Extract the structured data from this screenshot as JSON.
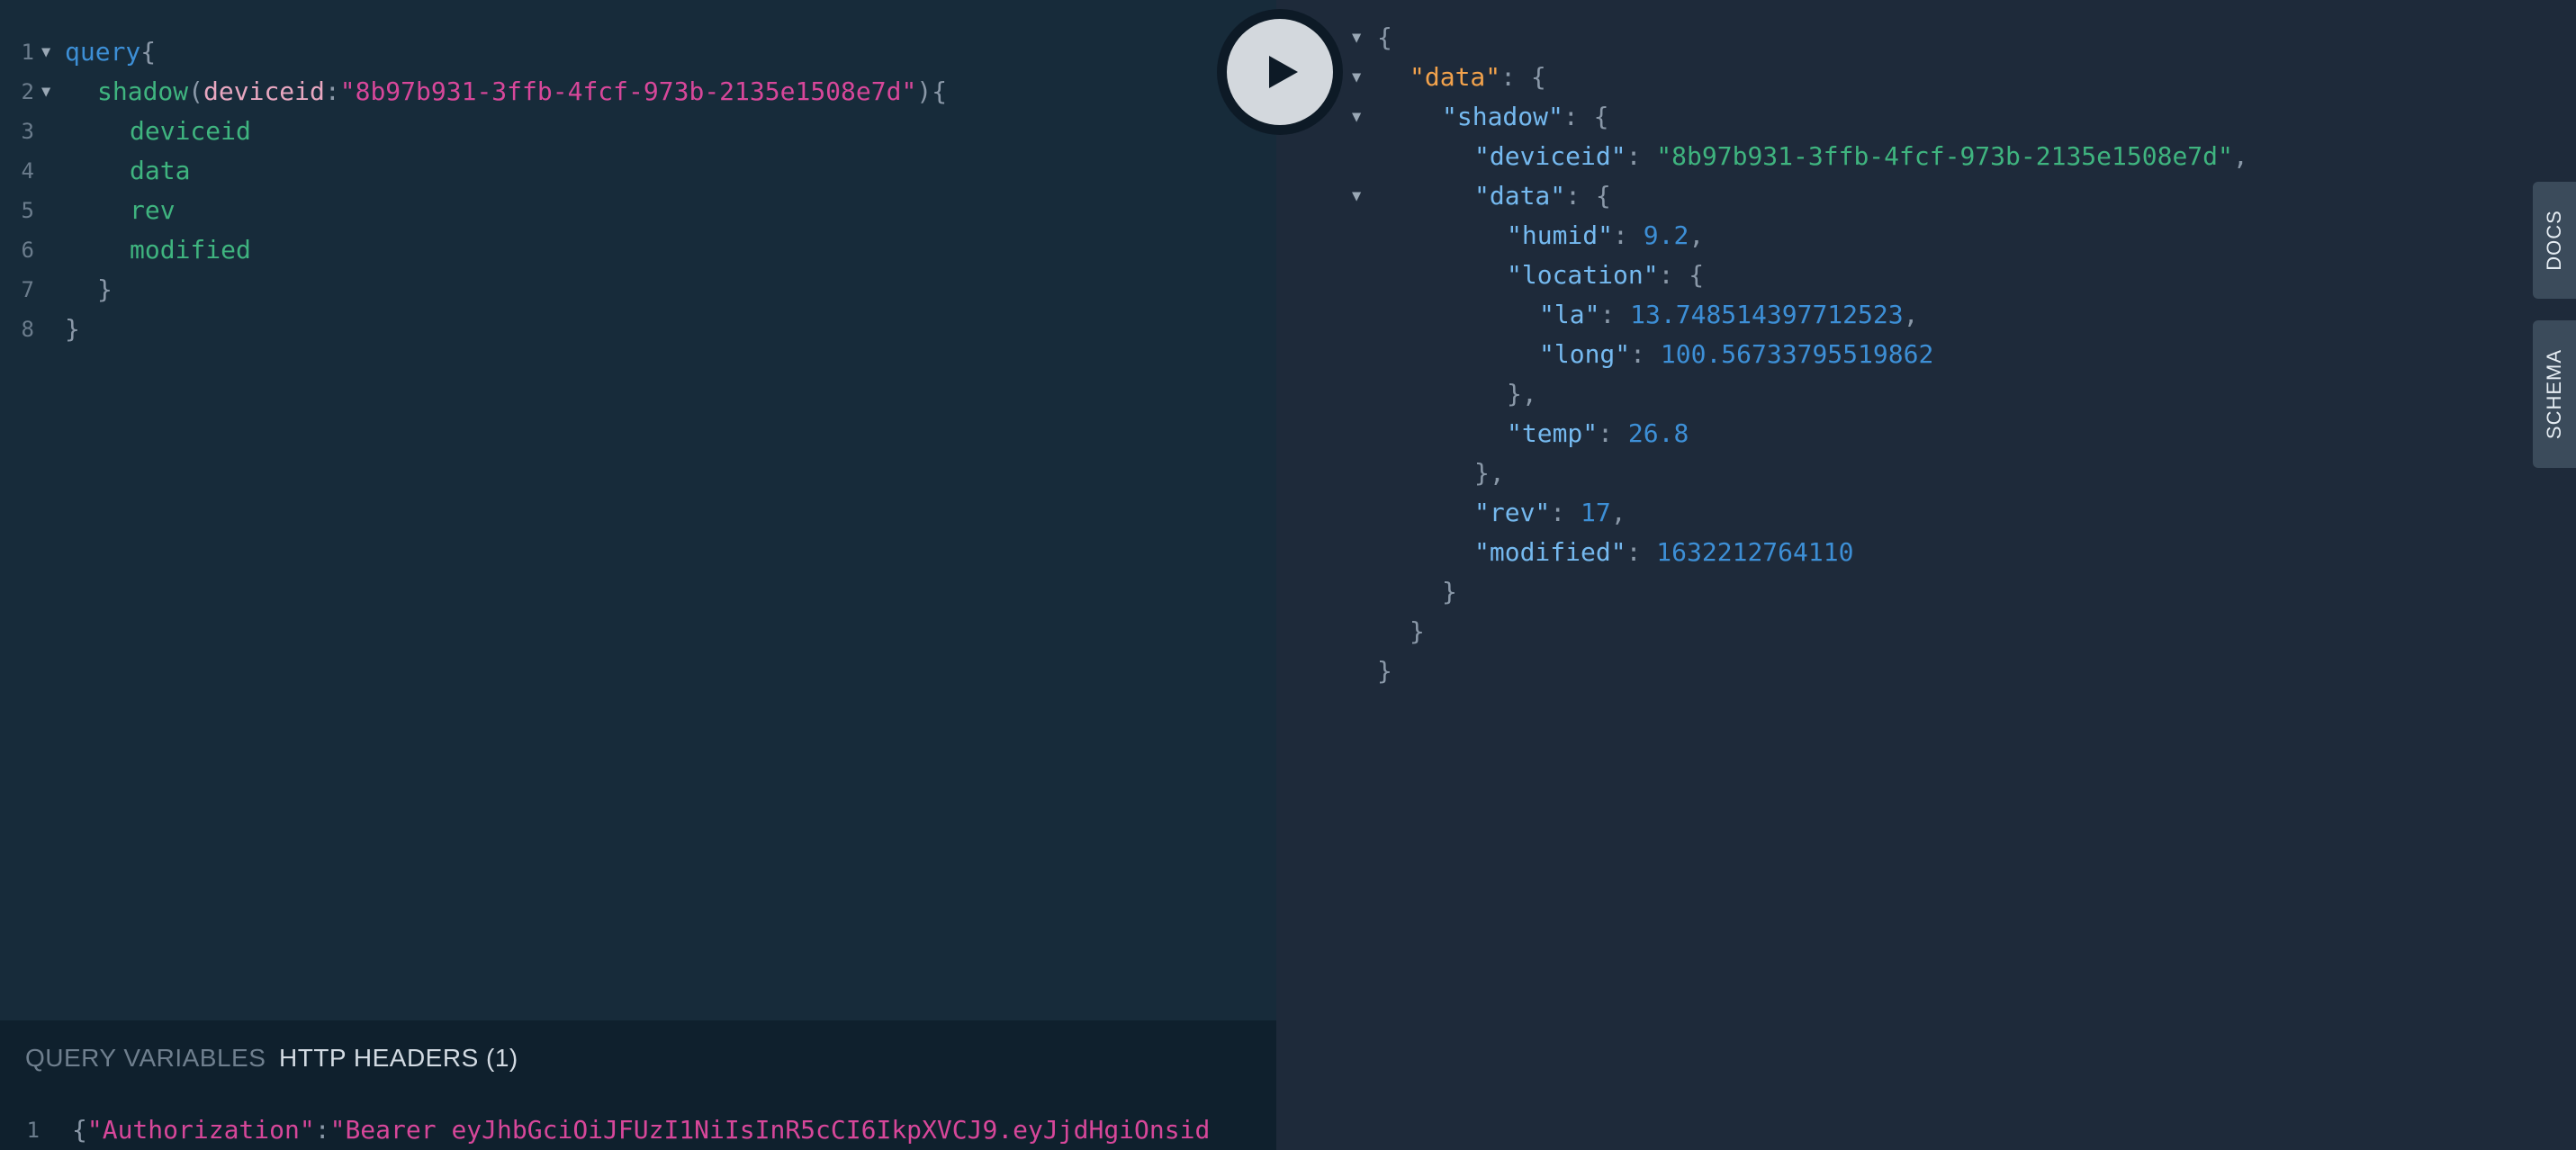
{
  "editor": {
    "line_numbers": [
      "1",
      "2",
      "3",
      "4",
      "5",
      "6",
      "7",
      "8"
    ],
    "query_keyword": "query",
    "open_brace": "{",
    "close_brace": "}",
    "shadow_field": "shadow",
    "paren_open": "(",
    "arg_name": "deviceid",
    "colon": ":",
    "arg_value": "\"8b97b931-3ffb-4fcf-973b-2135e1508e7d\"",
    "paren_close": ")",
    "fields": [
      "deviceid",
      "data",
      "rev",
      "modified"
    ]
  },
  "bottom_panel": {
    "tab_variables": "QUERY VARIABLES",
    "tab_headers": "HTTP HEADERS (1)",
    "line_number": "1",
    "header_open": "{",
    "header_key": "\"Authorization\"",
    "header_colon": ":",
    "header_value": "\"Bearer eyJhbGciOiJFUzI1NiIsInR5cCI6IkpXVCJ9.eyJjdHgiOnsid"
  },
  "result": {
    "open": "{",
    "data_key": "\"data\"",
    "shadow_key": "\"shadow\"",
    "deviceid_key": "\"deviceid\"",
    "deviceid_value": "\"8b97b931-3ffb-4fcf-973b-2135e1508e7d\"",
    "inner_data_key": "\"data\"",
    "humid_key": "\"humid\"",
    "humid_value": "9.2",
    "location_key": "\"location\"",
    "la_key": "\"la\"",
    "la_value": "13.748514397712523",
    "long_key": "\"long\"",
    "long_value": "100.56733795519862",
    "temp_key": "\"temp\"",
    "temp_value": "26.8",
    "rev_key": "\"rev\"",
    "rev_value": "17",
    "modified_key": "\"modified\"",
    "modified_value": "1632212764110",
    "close": "}",
    "close_comma": "},",
    "colon": ": ",
    "comma": ","
  },
  "side_tabs": {
    "docs": "DOCS",
    "schema": "SCHEMA"
  },
  "icons": {
    "run": "play-icon",
    "fold": "triangle-down-icon"
  },
  "colors": {
    "editor_bg": "#172b3a",
    "result_bg": "#1e2a3a",
    "keyword": "#3d8fd6",
    "field": "#3fb47f",
    "string": "#d7479a",
    "top_key": "#f2a24c"
  }
}
